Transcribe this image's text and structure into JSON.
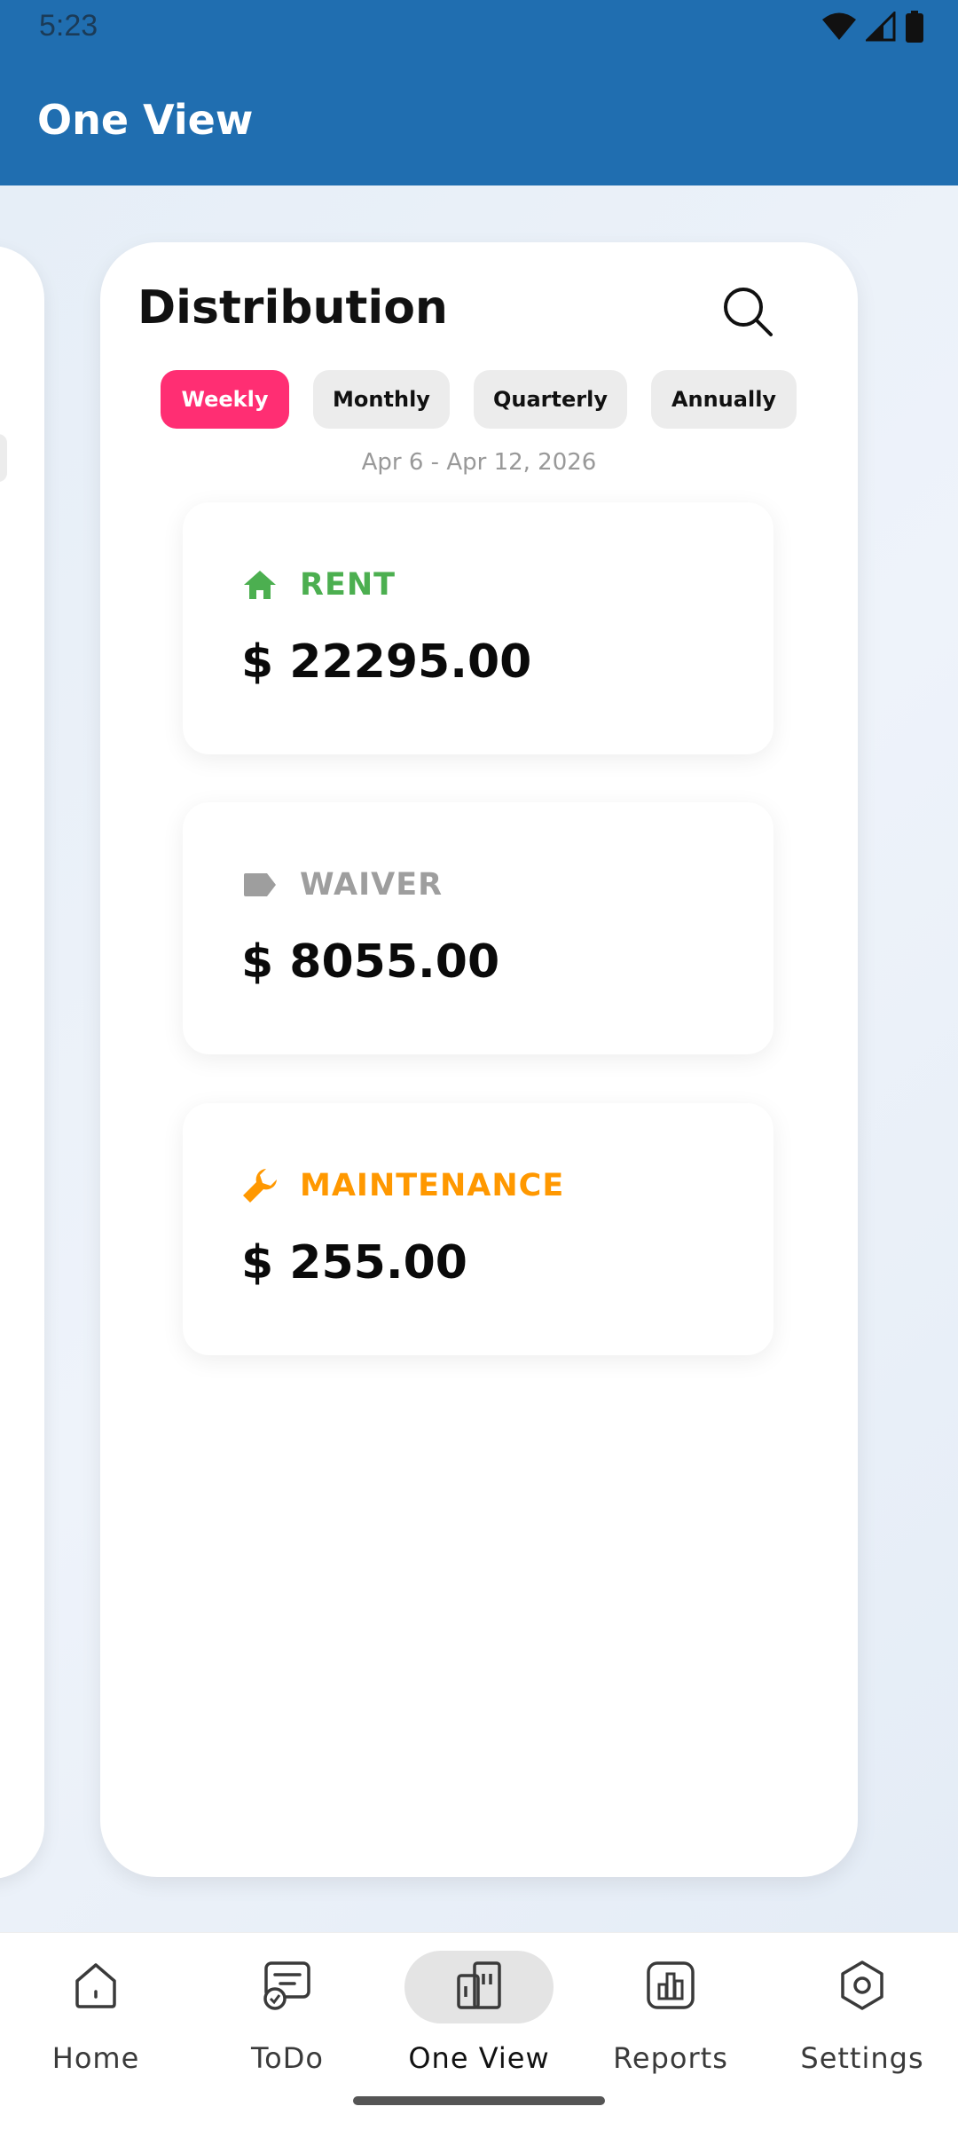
{
  "status_bar": {
    "time": "5:23",
    "icons": [
      "wifi-icon",
      "signal-icon",
      "battery-icon"
    ]
  },
  "app_bar": {
    "title": "One View",
    "background_color": "#206EB0"
  },
  "distribution": {
    "title": "Distribution",
    "search_icon": "search-icon",
    "filters": [
      {
        "label": "Weekly",
        "active": true
      },
      {
        "label": "Monthly",
        "active": false
      },
      {
        "label": "Quarterly",
        "active": false
      },
      {
        "label": "Annually",
        "active": false
      }
    ],
    "active_color": "#FF2E73",
    "date_range": "Apr 6 - Apr 12, 2026",
    "items": [
      {
        "category": "RENT",
        "amount": "$ 22295.00",
        "icon": "home-icon",
        "color": "#4CAF50"
      },
      {
        "category": "WAIVER",
        "amount": "$ 8055.00",
        "icon": "tag-icon",
        "color": "#9E9E9E"
      },
      {
        "category": "MAINTENANCE",
        "amount": "$ 255.00",
        "icon": "wrench-icon",
        "color": "#FF9800"
      }
    ]
  },
  "bottom_nav": {
    "items": [
      {
        "label": "Home",
        "icon": "home-outline-icon",
        "active": false
      },
      {
        "label": "ToDo",
        "icon": "todo-chat-icon",
        "active": false
      },
      {
        "label": "One View",
        "icon": "buildings-icon",
        "active": true
      },
      {
        "label": "Reports",
        "icon": "bar-chart-icon",
        "active": false
      },
      {
        "label": "Settings",
        "icon": "settings-hexagon-icon",
        "active": false
      }
    ]
  }
}
